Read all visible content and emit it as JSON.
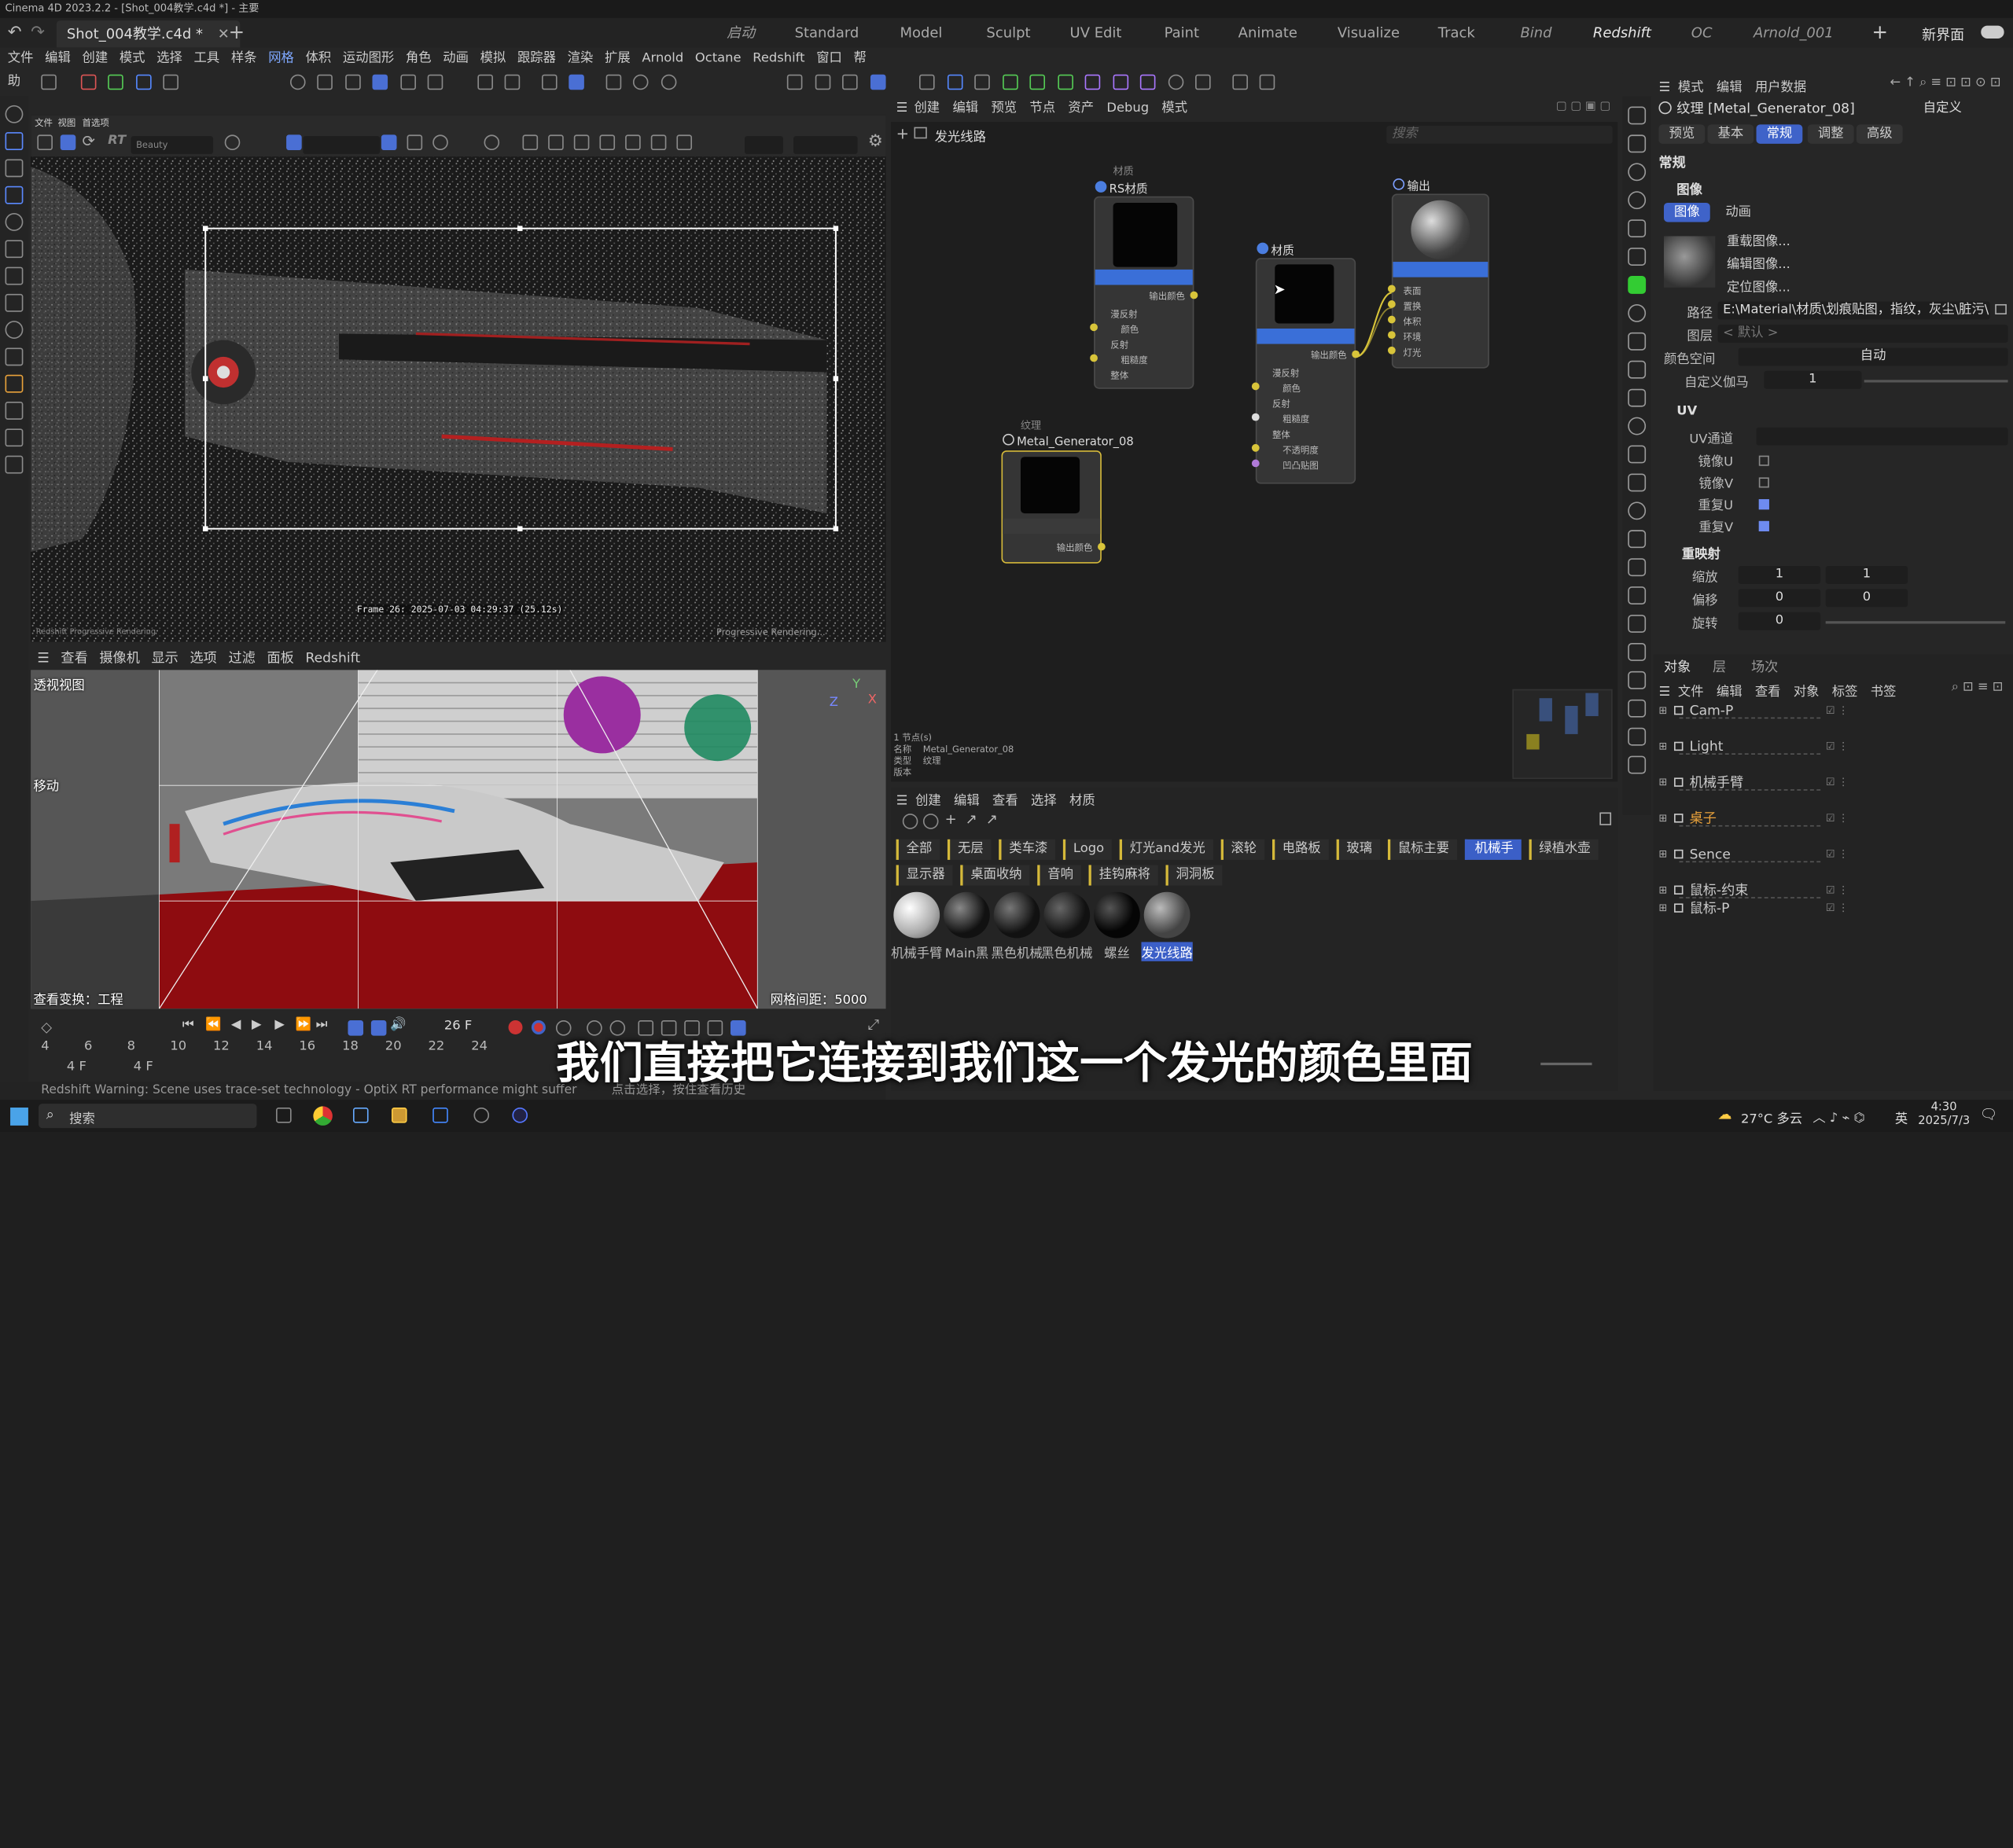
{
  "window": {
    "title": "Cinema 4D 2023.2.2 - [Shot_004教学.c4d *] - 主要"
  },
  "doc_tab": {
    "label": "Shot_004教学.c4d *"
  },
  "layouts": [
    "启动",
    "Standard",
    "Model",
    "Sculpt",
    "UV Edit",
    "Paint",
    "Animate",
    "Visualize",
    "Track",
    "Bind",
    "Redshift",
    "OC",
    "Arnold_001"
  ],
  "layouts_active": "Redshift",
  "new_ui_label": "新界面",
  "menu": [
    "文件",
    "编辑",
    "创建",
    "模式",
    "选择",
    "工具",
    "样条",
    "网格",
    "体积",
    "运动图形",
    "角色",
    "动画",
    "模拟",
    "跟踪器",
    "渲染",
    "扩展",
    "Arnold",
    "Octane",
    "Redshift",
    "窗口",
    "帮助"
  ],
  "menu_highlight": "网格",
  "render_view": {
    "menu": [
      "文件",
      "视图",
      "首选项"
    ],
    "mode": "Beauty",
    "frame_info": "Frame  26:  2025-07-03  04:29:37  (25.12s)",
    "status_left": "Redshift  Progressive  Rendering",
    "status_right": "Progressive Rendering..."
  },
  "viewport": {
    "menu": [
      "查看",
      "摄像机",
      "显示",
      "选项",
      "过滤",
      "面板",
      "Redshift"
    ],
    "label": "透视视图",
    "tool": "移动",
    "transform_label": "查看变换：工程",
    "grid_spacing": "网格间距：5000 cm"
  },
  "timeline": {
    "current_frame": "26 F",
    "ticks": [
      "4",
      "6",
      "8",
      "10",
      "12",
      "14",
      "16",
      "18",
      "20",
      "22",
      "24"
    ],
    "start": "4 F",
    "end": "4 F"
  },
  "node_editor": {
    "menu": [
      "创建",
      "编辑",
      "预览",
      "节点",
      "资产",
      "Debug",
      "模式"
    ],
    "breadcrumb": "发光线路",
    "search_placeholder": "搜索",
    "nodes": {
      "rs_material": {
        "category": "材质",
        "title": "RS材质",
        "output": "输出颜色",
        "ports": [
          "漫反射",
          "颜色",
          "反射",
          "粗糙度",
          "整体"
        ]
      },
      "material": {
        "title": "材质",
        "output": "输出颜色",
        "ports": [
          "漫反射",
          "颜色",
          "反射",
          "粗糙度",
          "整体",
          "不透明度",
          "凹凸贴图"
        ]
      },
      "output": {
        "title": "输出",
        "ports": [
          "表面",
          "置换",
          "体积",
          "环境",
          "灯光"
        ]
      },
      "texture": {
        "category": "纹理",
        "title": "Metal_Generator_08",
        "output": "输出颜色"
      }
    },
    "info": {
      "header": "1 节点(s)",
      "name_label": "名称",
      "name_value": "Metal_Generator_08",
      "type_label": "类型",
      "type_value": "纹理",
      "version_label": "版本"
    }
  },
  "material_manager": {
    "menu": [
      "创建",
      "编辑",
      "查看",
      "选择",
      "材质"
    ],
    "filters_row1": [
      "全部",
      "无层",
      "类车漆",
      "Logo",
      "灯光and发光",
      "滚轮",
      "电路板",
      "玻璃",
      "鼠标主要",
      "机械手",
      "绿植水壶"
    ],
    "filters_row2": [
      "显示器",
      "桌面收纳",
      "音响",
      "挂钩麻将",
      "洞洞板"
    ],
    "filter_selected": "机械手",
    "materials": [
      "机械手臂",
      "Main黑",
      "黑色机械",
      "黑色机械",
      "螺丝",
      "发光线路"
    ]
  },
  "attributes": {
    "menu": [
      "模式",
      "编辑",
      "用户数据"
    ],
    "title": "纹理 [Metal_Generator_08]",
    "preset": "自定义",
    "tabs": [
      "预览",
      "基本",
      "常规",
      "调整",
      "高级"
    ],
    "tab_active": "常规",
    "section_general": "常规",
    "group_image": "图像",
    "image_tabs": [
      "图像",
      "动画"
    ],
    "image_buttons": [
      "重载图像...",
      "编辑图像...",
      "定位图像..."
    ],
    "path_label": "路径",
    "path_value": "E:\\Material\\材质\\划痕贴图，指纹，灰尘\\脏污\\",
    "layer_label": "图层",
    "layer_value": "< 默认 >",
    "colorspace_label": "颜色空间",
    "colorspace_value": "自动",
    "gamma_label": "自定义伽马",
    "gamma_value": "1",
    "uv_section": "UV",
    "uv_channel_label": "UV通道",
    "mirror_u_label": "镜像U",
    "mirror_v_label": "镜像V",
    "repeat_u_label": "重复U",
    "repeat_v_label": "重复V",
    "remap_section": "重映射",
    "scale_label": "缩放",
    "scale_u": "1",
    "scale_v": "1",
    "offset_label": "偏移",
    "offset_u": "0",
    "offset_v": "0",
    "rotate_label": "旋转",
    "rotate_value": "0"
  },
  "object_manager": {
    "tabs": [
      "对象",
      "层",
      "场次"
    ],
    "menu": [
      "文件",
      "编辑",
      "查看",
      "对象",
      "标签",
      "书签"
    ],
    "objects": [
      "Cam-P",
      "Light",
      "机械手臂",
      "桌子",
      "Sence",
      "鼠标-约束",
      "鼠标-P"
    ]
  },
  "status_bar": {
    "warning": "Redshift Warning: Scene uses trace-set technology - OptiX RT performance might suffer",
    "hint": "点击选择，按住查看历史"
  },
  "subtitle": "我们直接把它连接到我们这一个发光的颜色里面",
  "taskbar": {
    "search": "搜索",
    "weather": "27°C 多云",
    "ime": "英",
    "time": "4:30",
    "date": "2025/7/3"
  },
  "colors": {
    "accent": "#3f63c9",
    "port_yellow": "#d8c43a",
    "port_purple": "#b07ad8",
    "red_floor": "#8a0c10"
  }
}
